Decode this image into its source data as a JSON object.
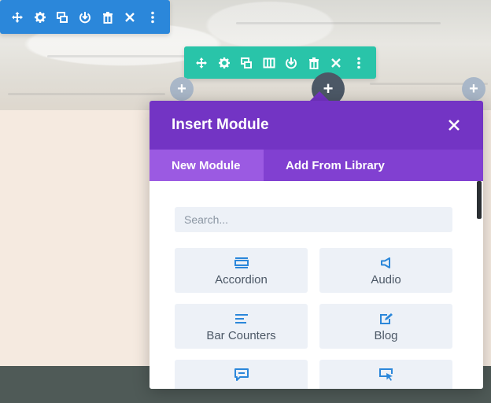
{
  "colors": {
    "row_toolbar": "#2b87da",
    "section_toolbar": "#29c4a9",
    "modal_header": "#7334c4",
    "modal_tabs": "#8140d1",
    "active_tab": "#9b5ae2",
    "card_bg": "#edf1f7",
    "icon_blue": "#2b87da",
    "text_dark": "#4c5866"
  },
  "row_toolbar": {
    "icons": [
      "move-icon",
      "gear-icon",
      "duplicate-icon",
      "save-icon",
      "trash-icon",
      "close-icon",
      "more-icon"
    ]
  },
  "section_toolbar": {
    "icons": [
      "move-icon",
      "gear-icon",
      "duplicate-icon",
      "columns-icon",
      "save-icon",
      "trash-icon",
      "close-icon",
      "more-icon"
    ]
  },
  "add_buttons": {
    "left_label": "+",
    "center_label": "+",
    "right_label": "+"
  },
  "modal": {
    "title": "Insert Module",
    "tabs": [
      {
        "label": "New Module",
        "active": true
      },
      {
        "label": "Add From Library",
        "active": false
      }
    ],
    "search": {
      "placeholder": "Search...",
      "value": ""
    },
    "modules": [
      {
        "label": "Accordion",
        "icon": "accordion-icon"
      },
      {
        "label": "Audio",
        "icon": "audio-icon"
      },
      {
        "label": "Bar Counters",
        "icon": "bar-counters-icon"
      },
      {
        "label": "Blog",
        "icon": "blog-icon"
      },
      {
        "label": "",
        "icon": "blurb-icon"
      },
      {
        "label": "",
        "icon": "button-icon"
      }
    ]
  }
}
